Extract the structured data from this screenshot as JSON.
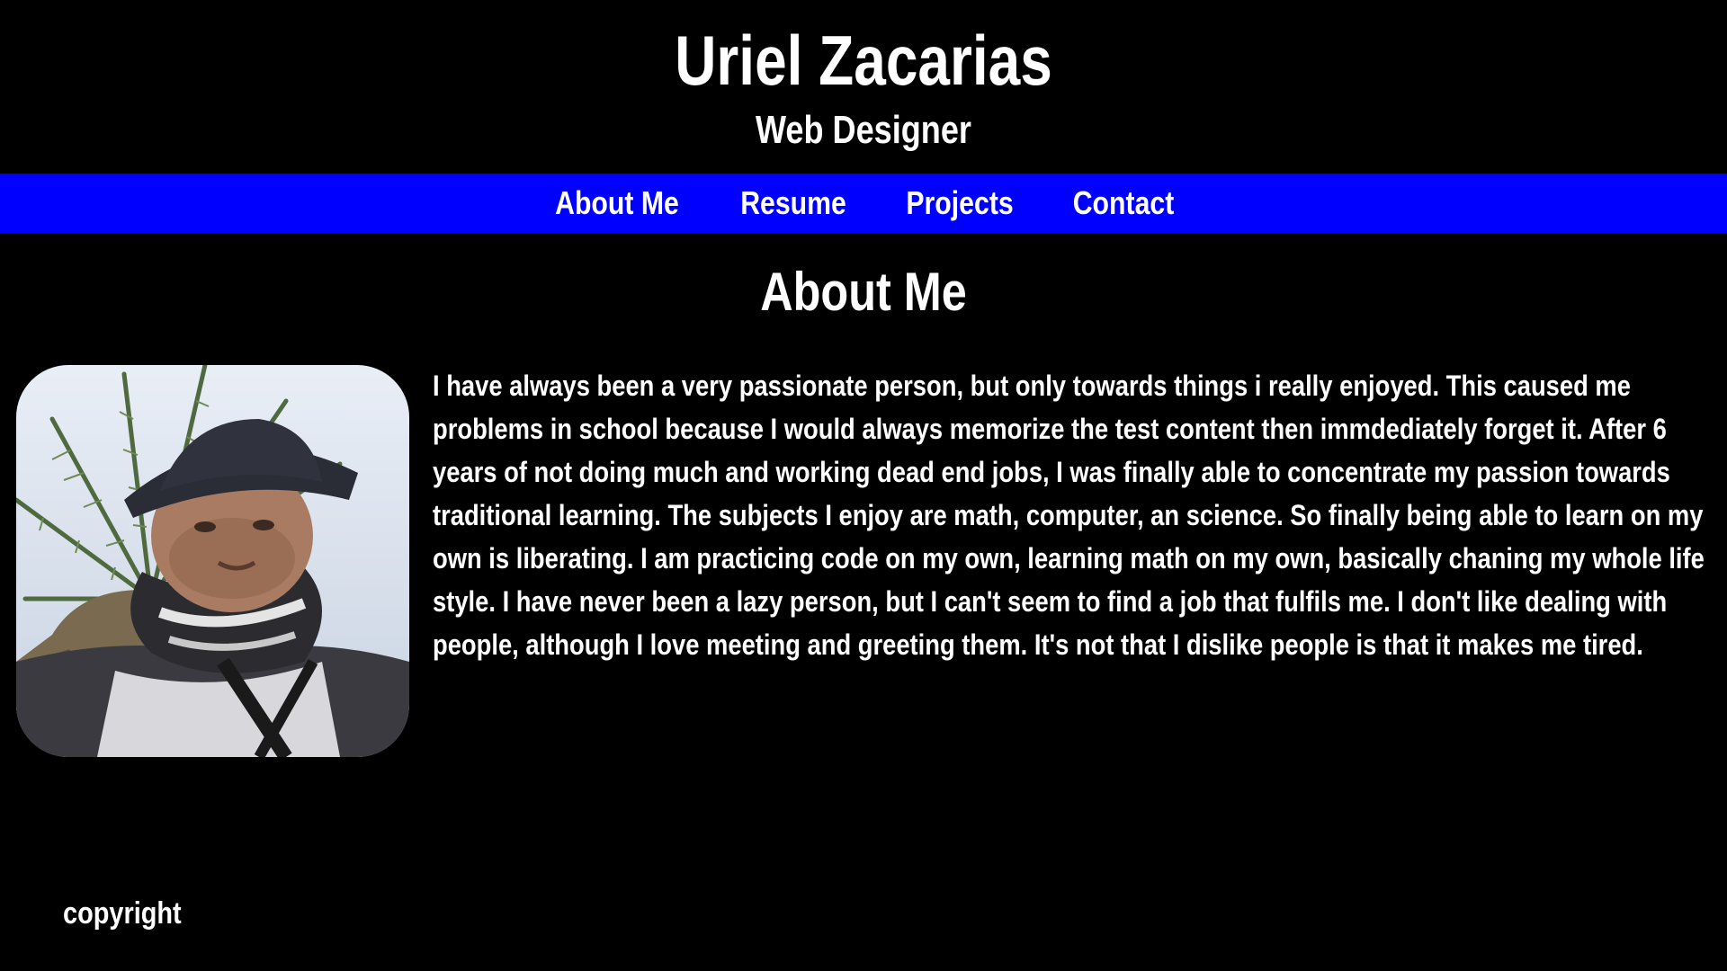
{
  "header": {
    "name": "Uriel Zacarias",
    "role": "Web Designer"
  },
  "nav": {
    "items": [
      {
        "label": "About Me"
      },
      {
        "label": "Resume"
      },
      {
        "label": "Projects"
      },
      {
        "label": "Contact"
      }
    ]
  },
  "main": {
    "title": "About Me",
    "bio": "I have always been a very passionate person, but only towards things i really enjoyed. This caused me problems in school because I would always memorize the test content then immdediately forget it. After 6 years of not doing much and working dead end jobs, I was finally able to concentrate my passion towards traditional learning. The subjects I enjoy are math, computer, an science. So finally being able to learn on my own is liberating. I am practicing code on my own, learning math on my own, basically chaning my whole life style. I have never been a lazy person, but I can't seem to find a job that fulfils me. I don't like dealing with people, although I love meeting and greeting them. It's not that I dislike people is that it makes me tired."
  },
  "footer": {
    "copyright": "copyright"
  },
  "colors": {
    "nav_background": "#0000ff",
    "page_background": "#000000",
    "text": "#ffffff"
  }
}
